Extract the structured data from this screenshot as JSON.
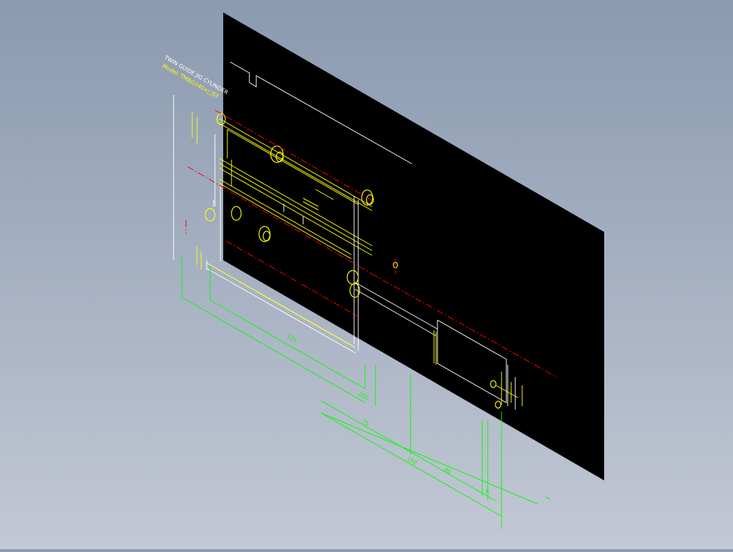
{
  "drawing": {
    "title_lines": [
      "TWIN GUIDE JIG CYLINDER",
      "Model: TMB(U)40×□ST"
    ],
    "dimensions": [
      "125",
      "250",
      "75",
      "150",
      "80",
      "6"
    ],
    "background": "#8a9ab0",
    "sheet_color": "#000000",
    "line_colors": {
      "outline": "#ffffff",
      "yellow": "#ffff00",
      "centerline": "#ff0000",
      "dimension": "#00ff00"
    }
  }
}
